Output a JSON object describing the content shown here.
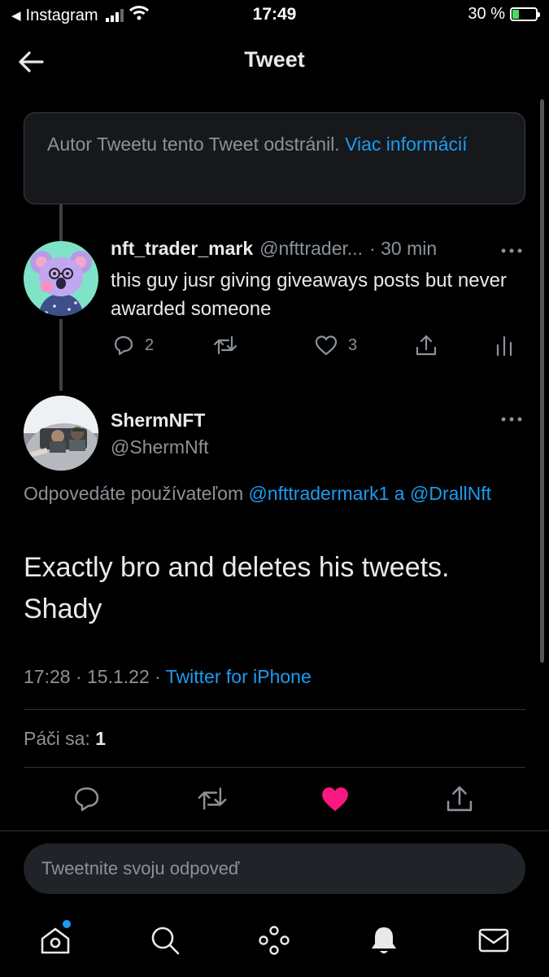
{
  "status_bar": {
    "back_app": "Instagram",
    "time": "17:49",
    "battery_text": "30 %",
    "battery_level": 0.3
  },
  "header": {
    "title": "Tweet"
  },
  "deleted_notice": {
    "text": "Autor Tweetu tento Tweet odstránil.",
    "link": "Viac informácií"
  },
  "parent_tweet": {
    "name": "nft_trader_mark",
    "handle": "@nfttrader...",
    "time": "· 30 min",
    "text": "this guy jusr giving giveaways posts but never awarded someone",
    "actions": {
      "replies": "2",
      "retweets": "",
      "likes": "3"
    }
  },
  "main_tweet": {
    "name": "ShermNFT",
    "handle": "@ShermNft",
    "reply_prefix": "Odpovedáte používateľom",
    "reply_user1": "@nfttradermark1",
    "reply_join": "a",
    "reply_user2": "@DrallNft",
    "text": "Exactly bro and deletes his tweets. Shady",
    "meta_time": "17:28 · 15.1.22 ·",
    "meta_source": "Twitter for iPhone",
    "likes_label": "Páči sa:",
    "likes_count": "1",
    "liked": true
  },
  "reply_input": {
    "placeholder": "Tweetnite svoju odpoveď"
  },
  "tab_bar": {
    "items": [
      "home-icon",
      "search-icon",
      "spaces-icon",
      "notifications-icon",
      "messages-icon"
    ]
  },
  "colors": {
    "accent": "#1d9bf0",
    "like": "#f91880",
    "muted": "#8b9299",
    "background": "#000000"
  }
}
